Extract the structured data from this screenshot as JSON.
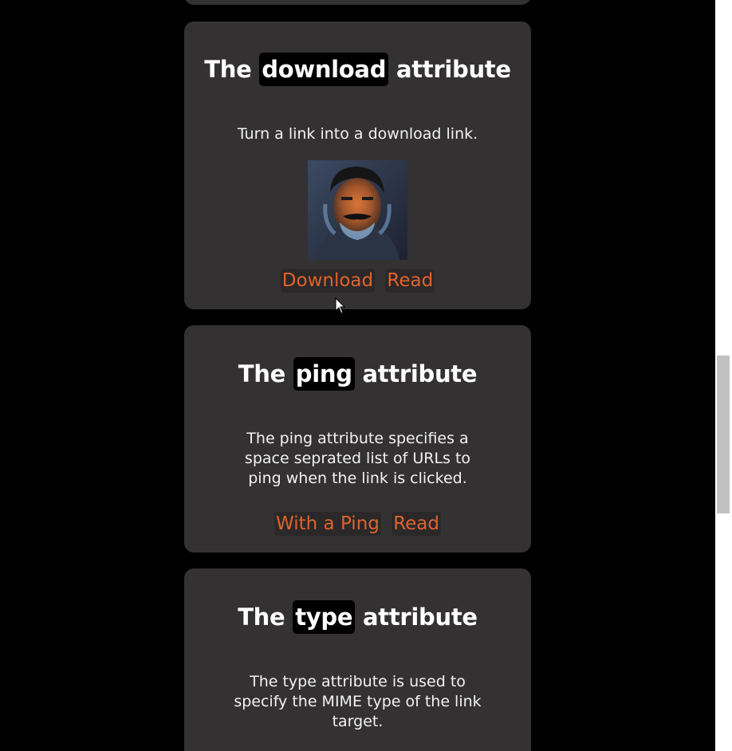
{
  "cards": [
    {
      "title_prefix": "The",
      "code": "download",
      "title_suffix": "attribute",
      "description": "Turn a link into a download link.",
      "links": [
        "Download",
        "Read"
      ]
    },
    {
      "title_prefix": "The",
      "code": "ping",
      "title_suffix": "attribute",
      "description": "The ping attribute specifies a space seprated list of URLs to ping when the link is clicked.",
      "links": [
        "With a Ping",
        "Read"
      ]
    },
    {
      "title_prefix": "The",
      "code": "type",
      "title_suffix": "attribute",
      "description": "The type attribute is used to specify the MIME type of the link target."
    }
  ],
  "colors": {
    "page_background": "#000000",
    "card_background": "#333132",
    "link": "#e0632c",
    "code_chip": "#000000"
  },
  "icons": {
    "cursor": "mouse-pointer-icon",
    "image": "portrait-image"
  }
}
